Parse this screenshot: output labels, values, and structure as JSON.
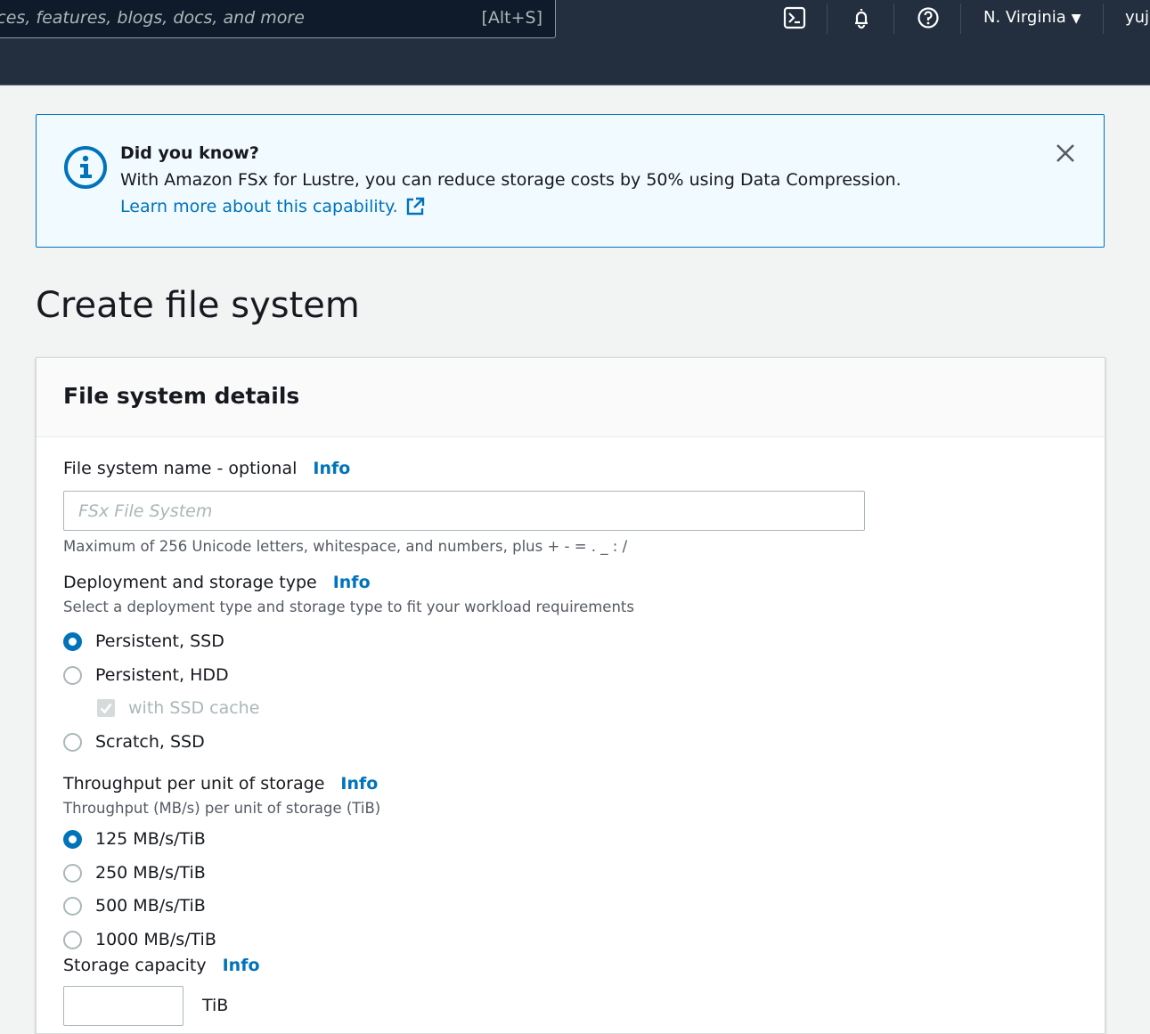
{
  "topnav": {
    "search_placeholder": "ices, features, blogs, docs, and more",
    "search_shortcut": "[Alt+S]",
    "region": "N. Virginia",
    "user": "yuji",
    "icons": [
      "cloudshell-icon",
      "notifications-bell-icon",
      "help-icon"
    ]
  },
  "infobar": {
    "title": "Did you know?",
    "body": "With Amazon FSx for Lustre, you can reduce storage costs by 50% using Data Compression.",
    "link": "Learn more about this capability.",
    "accent": "#0073bb"
  },
  "page": {
    "title": "Create file system"
  },
  "panel": {
    "title": "File system details",
    "name_field": {
      "label": "File system name - optional",
      "info": "Info",
      "placeholder": "FSx File System",
      "value": "",
      "hint": "Maximum of 256 Unicode letters, whitespace, and numbers, plus + - = . _ : /"
    },
    "deployment": {
      "label": "Deployment and storage type",
      "info": "Info",
      "description": "Select a deployment type and storage type to fit your workload requirements",
      "options": [
        {
          "label": "Persistent, SSD",
          "checked": true
        },
        {
          "label": "Persistent, HDD",
          "checked": false
        },
        {
          "label": "Scratch, SSD",
          "checked": false
        }
      ],
      "ssd_cache": {
        "label": "with SSD cache",
        "checked": true,
        "disabled": true
      }
    },
    "throughput": {
      "label": "Throughput per unit of storage",
      "info": "Info",
      "description": "Throughput (MB/s) per unit of storage (TiB)",
      "options": [
        {
          "label": "125 MB/s/TiB",
          "checked": true
        },
        {
          "label": "250 MB/s/TiB",
          "checked": false
        },
        {
          "label": "500 MB/s/TiB",
          "checked": false
        },
        {
          "label": "1000 MB/s/TiB",
          "checked": false
        }
      ]
    },
    "storage": {
      "label": "Storage capacity",
      "info": "Info",
      "value": "",
      "unit": "TiB"
    }
  }
}
